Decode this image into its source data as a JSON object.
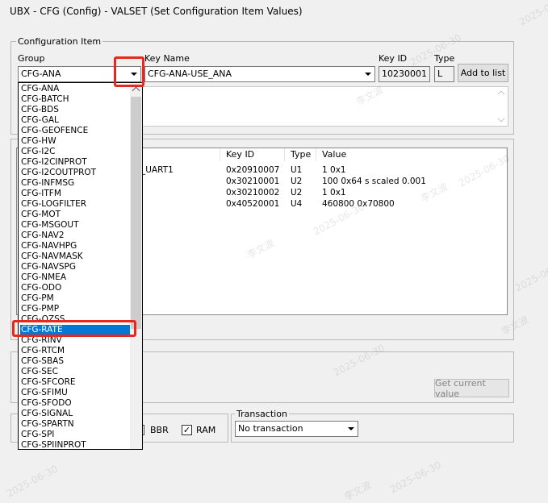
{
  "window": {
    "title": "UBX - CFG (Config) - VALSET (Set Configuration Item Values)"
  },
  "config_item": {
    "legend": "Configuration Item",
    "group_label": "Group",
    "group_value": "CFG-ANA",
    "key_name_label": "Key Name",
    "key_name_value": "CFG-ANA-USE_ANA",
    "key_id_label": "Key ID",
    "key_id_value": "10230001",
    "type_label": "Type",
    "type_value": "L",
    "add_button": "Add to list"
  },
  "items_table": {
    "columns": [
      "Key ID",
      "Type",
      "Value"
    ],
    "rows": [
      {
        "name": "_UART1",
        "key_id": "0x20910007",
        "type": "U1",
        "value": "1  0x1"
      },
      {
        "name": "",
        "key_id": "0x30210001",
        "type": "U2",
        "value": "100  0x64  s  scaled 0.001"
      },
      {
        "name": "",
        "key_id": "0x30210002",
        "type": "U2",
        "value": "1  0x1"
      },
      {
        "name": "",
        "key_id": "0x40520001",
        "type": "U4",
        "value": "460800  0x70800"
      }
    ]
  },
  "get_current_button": "Get current value",
  "layers": {
    "bbr_label": "BBR",
    "ram_label": "RAM",
    "ram_check": "✓"
  },
  "transaction": {
    "legend": "Transaction",
    "value": "No transaction"
  },
  "group_dropdown": {
    "options": [
      "CFG-ANA",
      "CFG-BATCH",
      "CFG-BDS",
      "CFG-GAL",
      "CFG-GEOFENCE",
      "CFG-HW",
      "CFG-I2C",
      "CFG-I2CINPROT",
      "CFG-I2COUTPROT",
      "CFG-INFMSG",
      "CFG-ITFM",
      "CFG-LOGFILTER",
      "CFG-MOT",
      "CFG-MSGOUT",
      "CFG-NAV2",
      "CFG-NAVHPG",
      "CFG-NAVMASK",
      "CFG-NAVSPG",
      "CFG-NMEA",
      "CFG-ODO",
      "CFG-PM",
      "CFG-PMP",
      "CFG-QZSS",
      "CFG-RATE",
      "CFG-RINV",
      "CFG-RTCM",
      "CFG-SBAS",
      "CFG-SEC",
      "CFG-SFCORE",
      "CFG-SFIMU",
      "CFG-SFODO",
      "CFG-SIGNAL",
      "CFG-SPARTN",
      "CFG-SPI",
      "CFG-SPIINPROT"
    ],
    "highlighted": "CFG-RATE"
  },
  "watermarks": [
    "李文波",
    "2025-06-30"
  ],
  "colors": {
    "selection": "#0078d7",
    "annotation_red": "#e8271e"
  },
  "icons": [
    "chevron-down-icon",
    "scroll-up-icon",
    "scroll-down-icon",
    "checkmark-icon"
  ]
}
